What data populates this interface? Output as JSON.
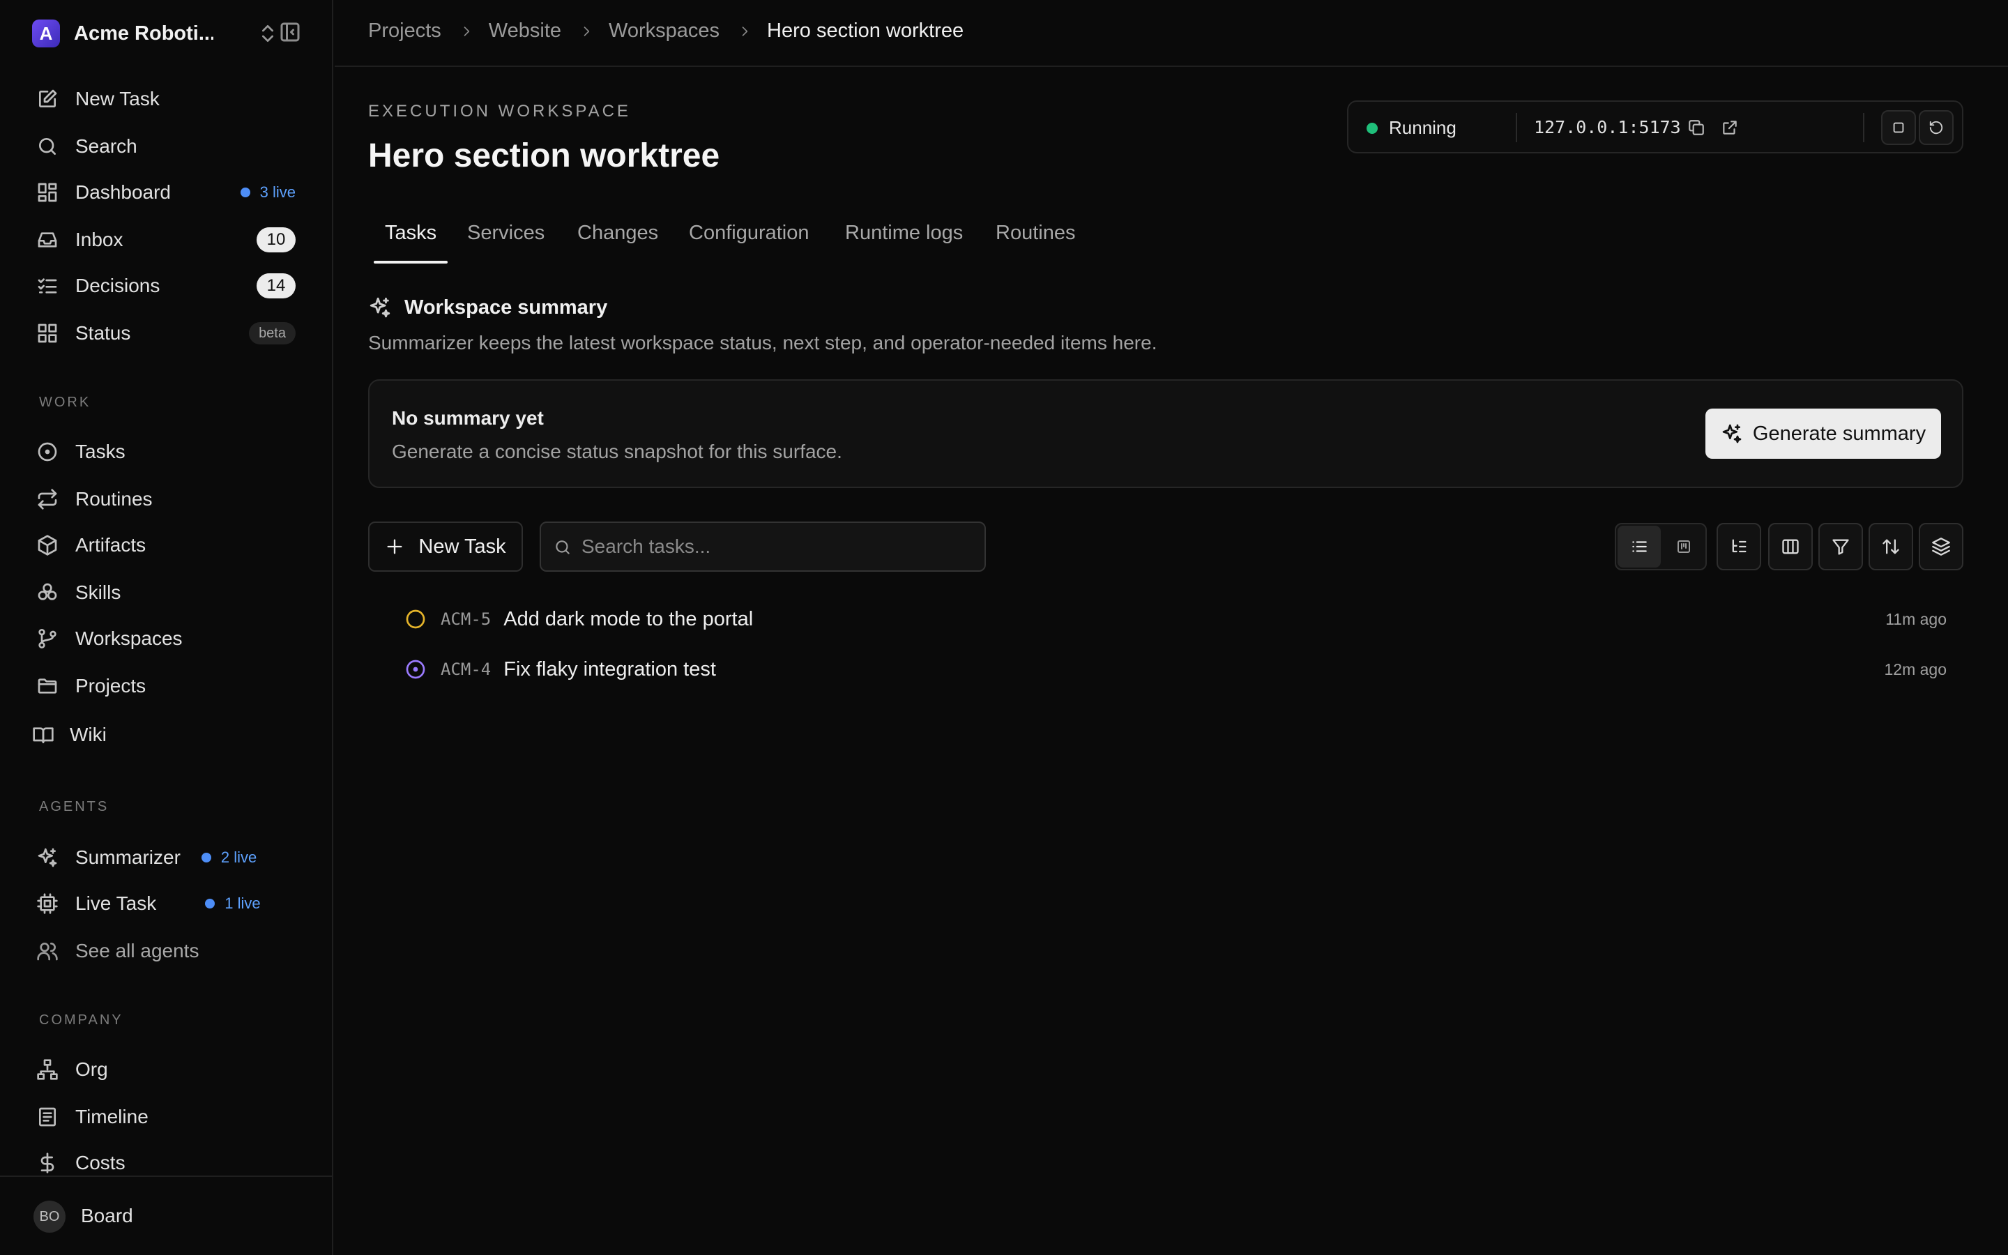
{
  "sidebar": {
    "brand": {
      "initial": "A",
      "name": "Acme Roboti..."
    },
    "nav": [
      {
        "label": "New Task",
        "icon": "edit-icon"
      },
      {
        "label": "Search",
        "icon": "search-icon"
      },
      {
        "label": "Dashboard",
        "icon": "dashboard-icon",
        "live": "3 live"
      },
      {
        "label": "Inbox",
        "icon": "inbox-icon",
        "count": "10"
      },
      {
        "label": "Decisions",
        "icon": "checklist-icon",
        "count": "14"
      },
      {
        "label": "Status",
        "icon": "grid-icon",
        "badge": "beta"
      }
    ],
    "work_label": "WORK",
    "work": [
      {
        "label": "Tasks",
        "icon": "circle-dot-icon"
      },
      {
        "label": "Routines",
        "icon": "repeat-icon"
      },
      {
        "label": "Artifacts",
        "icon": "package-icon"
      },
      {
        "label": "Skills",
        "icon": "boxes-icon"
      },
      {
        "label": "Workspaces",
        "icon": "git-branch-icon"
      },
      {
        "label": "Projects",
        "icon": "folder-icon"
      },
      {
        "label": "Wiki",
        "icon": "book-icon"
      }
    ],
    "agents_label": "AGENTS",
    "agents": [
      {
        "label": "Summarizer",
        "icon": "sparkles-icon",
        "live": "2 live"
      },
      {
        "label": "Live Task",
        "icon": "cpu-icon",
        "live": "1 live"
      },
      {
        "label": "See all agents",
        "icon": "users-icon"
      }
    ],
    "company_label": "COMPANY",
    "company": [
      {
        "label": "Org",
        "icon": "org-chart-icon"
      },
      {
        "label": "Timeline",
        "icon": "timeline-icon"
      },
      {
        "label": "Costs",
        "icon": "dollar-icon"
      }
    ],
    "footer": {
      "initials": "BO",
      "name": "Board"
    }
  },
  "breadcrumb": [
    "Projects",
    "Website",
    "Workspaces",
    "Hero section worktree"
  ],
  "header": {
    "eyebrow": "EXECUTION WORKSPACE",
    "title": "Hero section worktree"
  },
  "runtime": {
    "status": "Running",
    "status_color": "#1fbf7a",
    "url": "127.0.0.1:5173"
  },
  "tabs": [
    "Tasks",
    "Services",
    "Changes",
    "Configuration",
    "Runtime logs",
    "Routines"
  ],
  "active_tab": "Tasks",
  "summary": {
    "heading": "Workspace summary",
    "description": "Summarizer keeps the latest workspace status, next step, and operator-needed items here.",
    "card_title": "No summary yet",
    "card_desc": "Generate a concise status snapshot for this surface.",
    "button": "Generate summary"
  },
  "toolbar": {
    "new_task": "New Task",
    "search_placeholder": "Search tasks..."
  },
  "tasks": [
    {
      "key": "ACM-5",
      "title": "Add dark mode to the portal",
      "time": "11m ago",
      "status": "todo",
      "status_color": "#e5b42a"
    },
    {
      "key": "ACM-4",
      "title": "Fix flaky integration test",
      "time": "12m ago",
      "status": "in-progress",
      "status_color": "#9b7bff"
    }
  ]
}
